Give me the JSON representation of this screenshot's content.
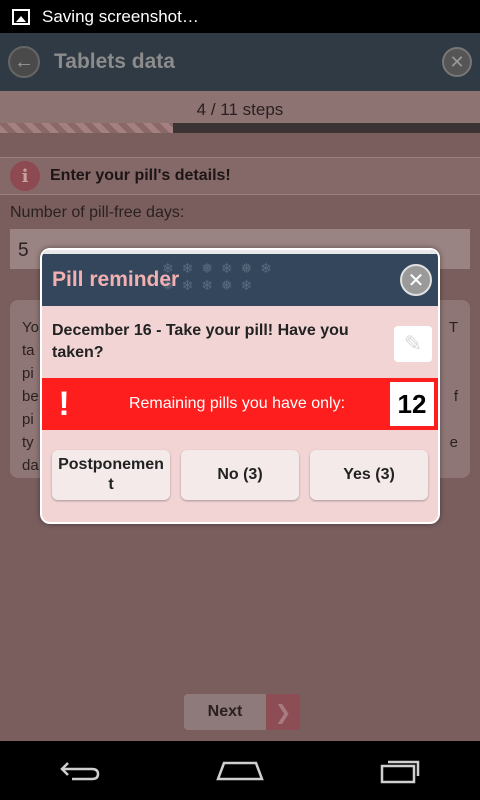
{
  "statusbar": {
    "text": "Saving screenshot…",
    "icon": "image-icon"
  },
  "appbar": {
    "title": "Tablets data"
  },
  "progress": {
    "steps_text": "4 / 11 steps",
    "fraction": 0.36
  },
  "info": {
    "text": "Enter your pill's details!"
  },
  "form": {
    "label": "Number of pill-free days:",
    "value": "5"
  },
  "background_card": {
    "left_fragments": [
      "Yo",
      "ta",
      "pi",
      "be",
      "pi",
      "ty",
      "da"
    ],
    "right_fragments": [
      "T",
      "",
      "",
      "f",
      "",
      "e",
      ""
    ]
  },
  "next": {
    "label": "Next"
  },
  "dialog": {
    "title": "Pill reminder",
    "message": "December 16 - Take your pill! Have you taken?",
    "warning_text": "Remaining pills you have only:",
    "remaining_count": "12",
    "buttons": {
      "postpone": "Postponement",
      "no": "No (3)",
      "yes": "Yes (3)"
    }
  },
  "colors": {
    "warning": "#ff1e1e",
    "dialog_header": "#33465c",
    "dialog_bg": "#f2d4d4"
  }
}
